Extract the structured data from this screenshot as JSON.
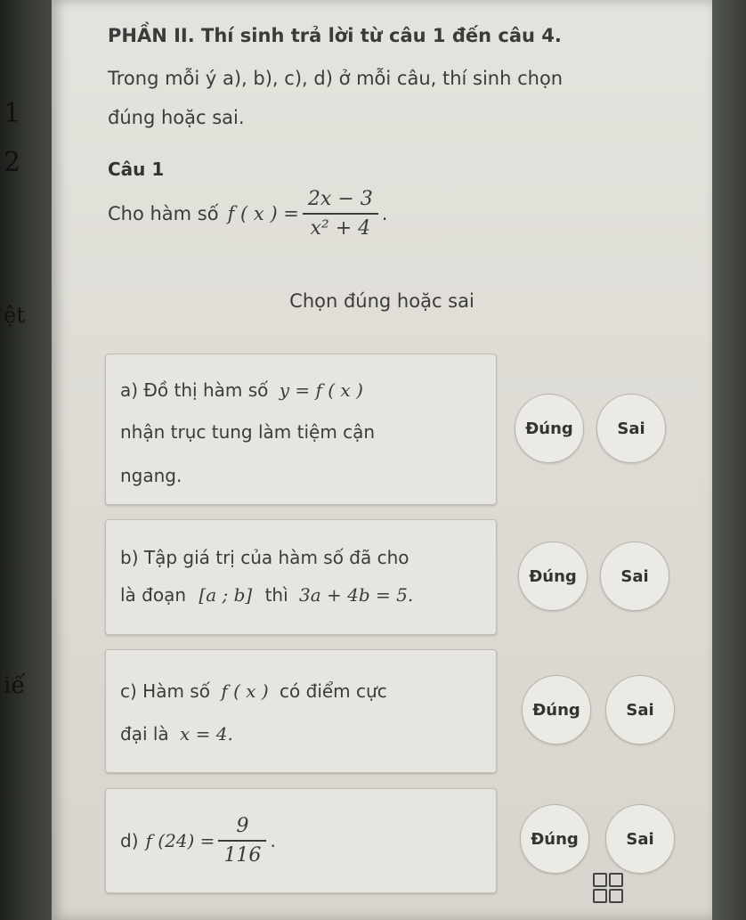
{
  "section": {
    "title": "PHẦN II. Thí sinh trả lời từ câu 1 đến câu 4.",
    "line2": "Trong mỗi ý a), b), c), d) ở mỗi câu, thí sinh chọn",
    "line3": "đúng hoặc sai."
  },
  "question": {
    "title": "Câu 1",
    "prefix": "Cho hàm số",
    "func": "f ( x ) =",
    "numerator": "2x − 3",
    "denominator": "x² + 4",
    "suffix": "."
  },
  "instruction": "Chọn đúng hoặc sai",
  "items": [
    {
      "line1_text": "a) Đồ thị hàm số",
      "line1_math": "y = f ( x )",
      "line2": "nhận trục tung làm tiệm cận",
      "line3": "ngang.",
      "true_label": "Đúng",
      "false_label": "Sai"
    },
    {
      "line1": "b) Tập giá trị của hàm số đã cho",
      "line2_text": "là đoạn",
      "line2_math1": "[a ; b]",
      "line2_mid": "thì",
      "line2_math2": "3a + 4b = 5.",
      "true_label": "Đúng",
      "false_label": "Sai"
    },
    {
      "line1_text": "c) Hàm số",
      "line1_math": "f ( x )",
      "line1_rest": "có điểm cực",
      "line2_text": "đại là",
      "line2_math": "x = 4.",
      "true_label": "Đúng",
      "false_label": "Sai"
    },
    {
      "prefix": "d)",
      "func": "f (24) =",
      "numerator": "9",
      "denominator": "116",
      "suffix": ".",
      "true_label": "Đúng",
      "false_label": "Sai"
    }
  ],
  "edge_glyphs": [
    "1",
    "2",
    "ệt",
    "iế"
  ]
}
